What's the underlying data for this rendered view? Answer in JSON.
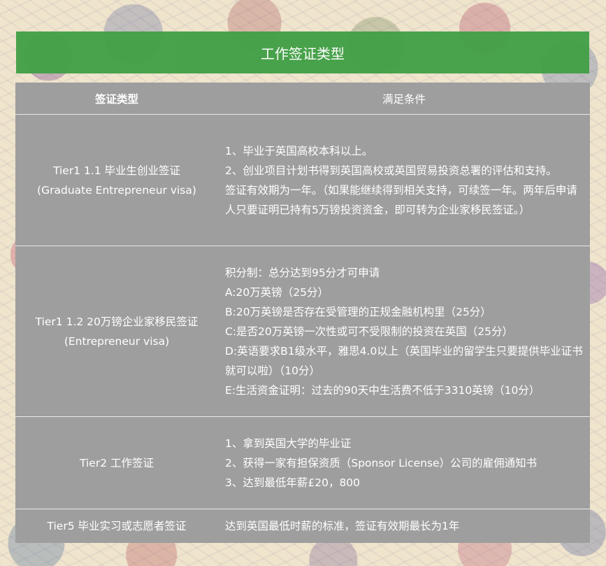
{
  "title": "工作签证类型",
  "table": {
    "headers": {
      "type": "签证类型",
      "conditions": "满足条件"
    },
    "rows": [
      {
        "type_lines": [
          "Tier1 1.1 毕业生创业签证",
          "(Graduate Entrepreneur visa)"
        ],
        "condition_lines": [
          "1、毕业于英国高校本科以上。",
          "2、创业项目计划书得到英国高校或英国贸易投资总署的评估和支持。",
          "签证有效期为一年。（如果能继续得到相关支持，可续签一年。两年后申请人只要证明已持有5万镑投资资金，即可转为企业家移民签证。）"
        ]
      },
      {
        "type_lines": [
          "Tier1 1.2 20万镑企业家移民签证",
          "(Entrepreneur visa)"
        ],
        "condition_lines": [
          "积分制：总分达到95分才可申请",
          "A:20万英镑（25分）",
          "B:20万英镑是否存在受管理的正规金融机构里（25分）",
          "C:是否20万英镑一次性或可不受限制的投资在英国（25分）",
          "D:英语要求B1级水平，雅思4.0以上（英国毕业的留学生只要提供毕业证书就可以啦）（10分）",
          "E:生活资金证明：过去的90天中生活费不低于3310英镑（10分）"
        ]
      },
      {
        "type_lines": [
          "Tier2 工作签证"
        ],
        "condition_lines": [
          "1、拿到英国大学的毕业证",
          "2、获得一家有担保资质（Sponsor License）公司的雇佣通知书",
          "3、达到最低年薪£20，800"
        ]
      },
      {
        "type_lines": [
          "Tier5 毕业实习或志愿者签证"
        ],
        "condition_lines": [
          "达到英国最低时薪的标准，签证有效期最长为1年"
        ]
      }
    ]
  }
}
